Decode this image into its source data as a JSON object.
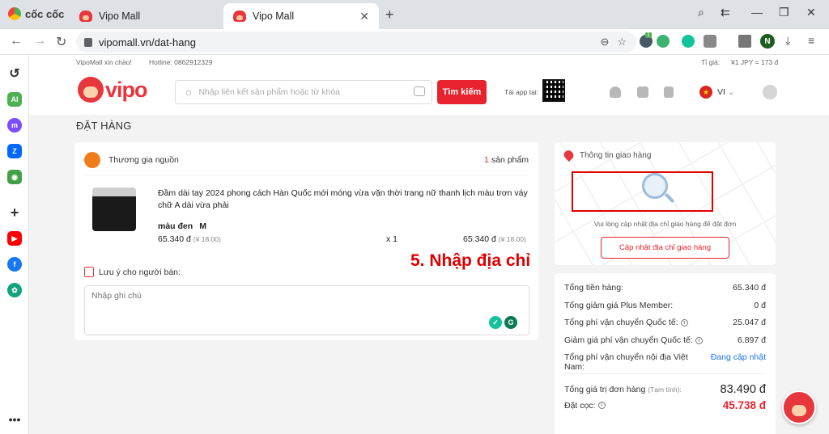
{
  "browser": {
    "brand": "cốc cốc",
    "tabs": [
      {
        "title": "Vipo Mall",
        "active": false
      },
      {
        "title": "Vipo Mall",
        "active": true
      }
    ],
    "new_tab": "+",
    "url": "vipomall.vn/dat-hang",
    "extension_badge": "1",
    "profile_initial": "N"
  },
  "topstrip": {
    "greeting": "VipoMall xin chào!",
    "hotline": "Hotline: 0862912329",
    "rate_label": "Tỉ giá:",
    "rate_value": "¥1 JPY = 173 đ"
  },
  "header": {
    "logo_text": "vipo",
    "search_placeholder": "Nhập liên kết sản phẩm hoặc từ khóa",
    "search_button": "Tìm kiếm",
    "app_label": "Tải app tại:",
    "language": "VI"
  },
  "page_title": "ĐẶT HÀNG",
  "order": {
    "shop_name": "Thương gia nguồn",
    "count_num": "1",
    "count_label": "sản phẩm",
    "product": {
      "name": "Đầm dài tay 2024 phong cách Hàn Quốc mới móng vừa vặn thời trang nữ thanh lịch màu trơn váy chữ A dài vừa phải",
      "color": "màu đen",
      "size": "M",
      "unit_price": "65.340 đ",
      "unit_price_yen": "(¥ 18.00)",
      "quantity": "x 1",
      "total_price": "65.340 đ",
      "total_price_yen": "(¥ 18.00)"
    },
    "note_label": "Lưu ý cho người bán:",
    "note_placeholder": "Nhập ghi chú"
  },
  "shipping": {
    "title": "Thông tin giao hàng",
    "hint": "Vui lòng cập nhật địa chỉ giao hàng để đặt đơn",
    "button": "Cập nhật địa chỉ giao hàng"
  },
  "summary": {
    "rows": [
      {
        "label": "Tổng tiền hàng:",
        "value": "65.340 đ"
      },
      {
        "label": "Tổng giảm giá Plus Member:",
        "value": "0 đ"
      },
      {
        "label": "Tổng phí vận chuyển Quốc tế:",
        "value": "25.047 đ"
      },
      {
        "label": "Giảm giá phí vận chuyển Quốc tế:",
        "value": "6.897 đ"
      },
      {
        "label": "Tổng phí vận chuyển nội địa Việt Nam:",
        "value": "Đang cập nhật"
      }
    ],
    "total_label": "Tổng giá trị đơn hàng",
    "total_note": "(Tạm tính):",
    "total_value": "83.490 đ",
    "deposit_label": "Đặt cọc:",
    "deposit_value": "45.738 đ",
    "info_symbol": "i"
  },
  "annotation": "5. Nhập địa chỉ",
  "colors": {
    "brand_red": "#e8232d",
    "highlight_red": "#e00000",
    "link_blue": "#1a73e8"
  }
}
